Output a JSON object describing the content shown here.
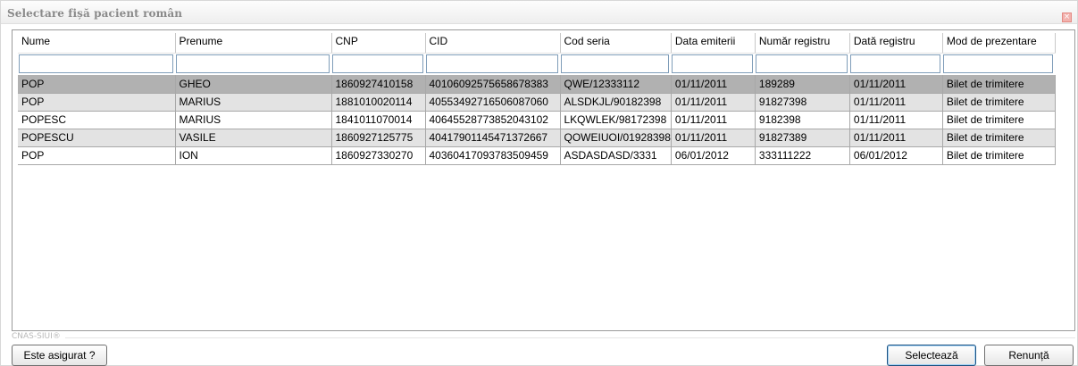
{
  "window": {
    "title": "Selectare fișă pacient român",
    "close_glyph": "×"
  },
  "grid": {
    "columns": [
      {
        "label": "Nume"
      },
      {
        "label": "Prenume"
      },
      {
        "label": "CNP"
      },
      {
        "label": "CID"
      },
      {
        "label": "Cod seria"
      },
      {
        "label": "Data emiterii"
      },
      {
        "label": "Număr registru"
      },
      {
        "label": "Dată registru"
      },
      {
        "label": "Mod de prezentare"
      }
    ],
    "filters": [
      "",
      "",
      "",
      "",
      "",
      "",
      "",
      "",
      ""
    ],
    "rows": [
      [
        "POP",
        "GHEO",
        "1860927410158",
        "40106092575658678383",
        "QWE/12333112",
        "01/11/2011",
        "189289",
        "01/11/2011",
        "Bilet de trimitere"
      ],
      [
        "POP",
        "MARIUS",
        "1881010020114",
        "40553492716506087060",
        "ALSDKJL/90182398",
        "01/11/2011",
        "91827398",
        "01/11/2011",
        "Bilet de trimitere"
      ],
      [
        "POPESC",
        "MARIUS",
        "1841011070014",
        "40645528773852043102",
        "LKQWLEK/98172398",
        "01/11/2011",
        "9182398",
        "01/11/2011",
        "Bilet de trimitere"
      ],
      [
        "POPESCU",
        "VASILE",
        "1860927125775",
        "40417901145471372667",
        "QOWEIUOI/01928398",
        "01/11/2011",
        "91827389",
        "01/11/2011",
        "Bilet de trimitere"
      ],
      [
        "POP",
        "ION",
        "1860927330270",
        "40360417093783509459",
        "ASDASDASD/3331",
        "06/01/2012",
        "333111222",
        "06/01/2012",
        "Bilet de trimitere"
      ]
    ]
  },
  "footer": {
    "brand": "CNAS-SIUI®",
    "is_insured_label": "Este asigurat ?",
    "select_label": "Selectează",
    "cancel_label": "Renunță"
  }
}
